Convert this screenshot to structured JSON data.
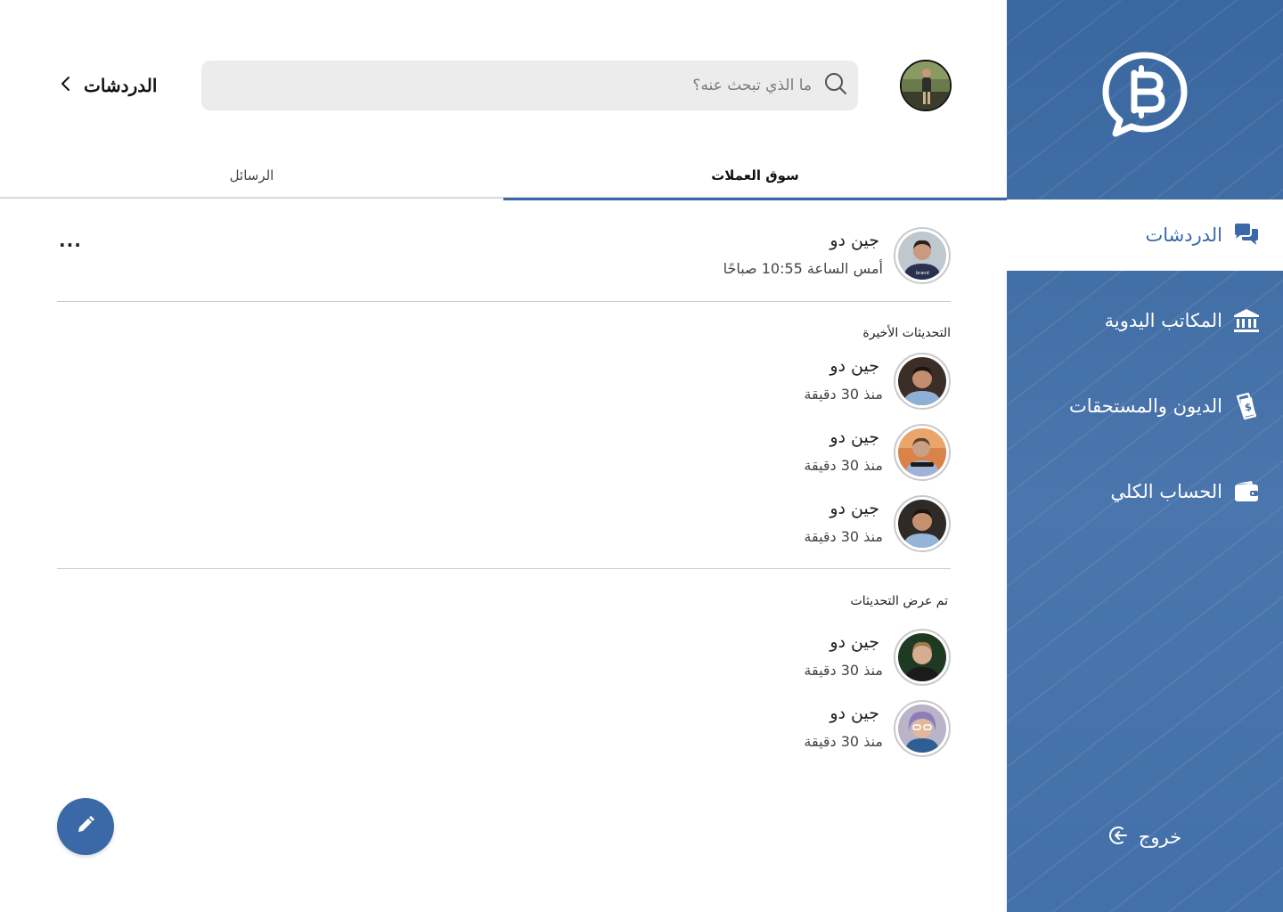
{
  "header": {
    "title": "الدردشات",
    "search_placeholder": "ما الذي تبحث عنه؟"
  },
  "tabs": [
    {
      "label": "سوق العملات",
      "active": true
    },
    {
      "label": "الرسائل",
      "active": false
    }
  ],
  "pinned_chat": {
    "name": "جين دو",
    "time": "أمس الساعة 10:55 صباحًا"
  },
  "sections": [
    {
      "title": "التحديثات الأخيرة",
      "items": [
        {
          "name": "جين دو",
          "time": "منذ 30 دقيقة"
        },
        {
          "name": "جين دو",
          "time": "منذ 30 دقيقة"
        },
        {
          "name": "جين دو",
          "time": "منذ 30 دقيقة"
        }
      ]
    },
    {
      "title": "تم عرض التحديثات",
      "items": [
        {
          "name": "جين دو",
          "time": "منذ 30 دقيقة"
        },
        {
          "name": "جين دو",
          "time": "منذ 30 دقيقة"
        }
      ]
    }
  ],
  "more_label": "...",
  "sidebar": {
    "items": [
      {
        "label": "الدردشات",
        "icon": "chat-bubbles-icon",
        "active": true
      },
      {
        "label": "المكاتب اليدوية",
        "icon": "bank-icon",
        "active": false
      },
      {
        "label": "الديون والمستحقات",
        "icon": "money-bill-icon",
        "active": false
      },
      {
        "label": "الحساب الكلي",
        "icon": "wallet-icon",
        "active": false
      }
    ],
    "logout_label": "خروج"
  },
  "colors": {
    "brand": "#3b69a8",
    "sidebar_top": "#3a679f",
    "search_bg": "#ececec",
    "divider": "#c8c8c8"
  }
}
